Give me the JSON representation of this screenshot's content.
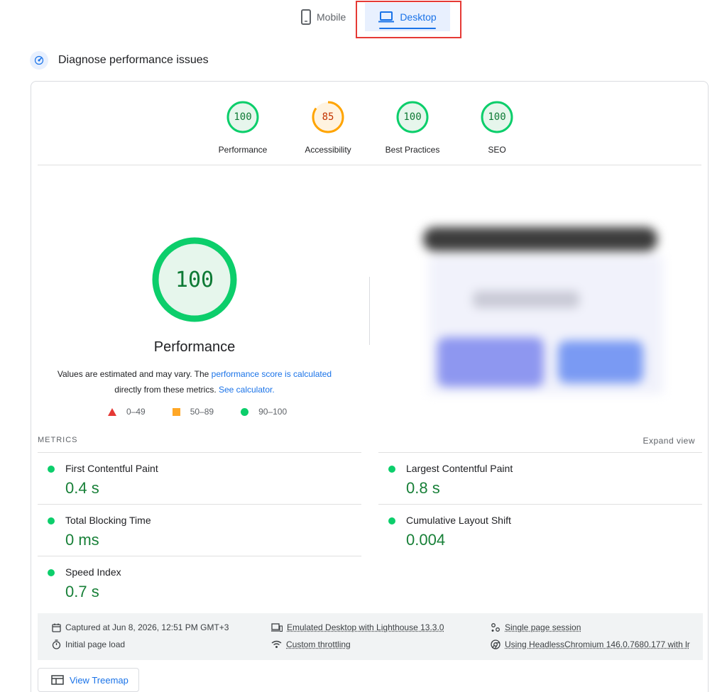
{
  "tabs": {
    "mobile_label": "Mobile",
    "desktop_label": "Desktop",
    "active": "Desktop"
  },
  "section": {
    "title": "Diagnose performance issues"
  },
  "categories": [
    {
      "label": "Performance",
      "score": "100",
      "status": "pass",
      "fraction": 1.0
    },
    {
      "label": "Accessibility",
      "score": "85",
      "status": "average",
      "fraction": 0.85
    },
    {
      "label": "Best Practices",
      "score": "100",
      "status": "pass",
      "fraction": 1.0
    },
    {
      "label": "SEO",
      "score": "100",
      "status": "pass",
      "fraction": 1.0
    }
  ],
  "performance": {
    "score": "100",
    "label": "Performance",
    "desc_prefix": "Values are estimated and may vary. The ",
    "desc_link": "performance score is calculated",
    "desc_middle": "directly from these metrics. ",
    "desc_link2": "See calculator."
  },
  "legend": {
    "fail": "0–49",
    "average": "50–89",
    "pass": "90–100"
  },
  "metrics": {
    "heading": "METRICS",
    "expand_label": "Expand view",
    "items": [
      {
        "name": "First Contentful Paint",
        "value": "0.4 s"
      },
      {
        "name": "Largest Contentful Paint",
        "value": "0.8 s"
      },
      {
        "name": "Total Blocking Time",
        "value": "0 ms"
      },
      {
        "name": "Cumulative Layout Shift",
        "value": "0.004"
      },
      {
        "name": "Speed Index",
        "value": "0.7 s"
      }
    ]
  },
  "runtime": {
    "captured": "Captured at Jun 8, 2026, 12:51 PM GMT+3",
    "load": "Initial page load",
    "emulated": "Emulated Desktop with Lighthouse 13.3.0",
    "throttling": "Custom throttling",
    "session": "Single page session",
    "browser": "Using HeadlessChromium 146.0.7680.177 with lr"
  },
  "treemap": {
    "label": "View Treemap"
  },
  "colors": {
    "pass": "#0cce6b",
    "pass_text": "#0d7a35",
    "average": "#ffa400",
    "average_text": "#c33300",
    "fail": "#ff4e42",
    "accent": "#1a73e8",
    "highlight": "#e53935"
  }
}
